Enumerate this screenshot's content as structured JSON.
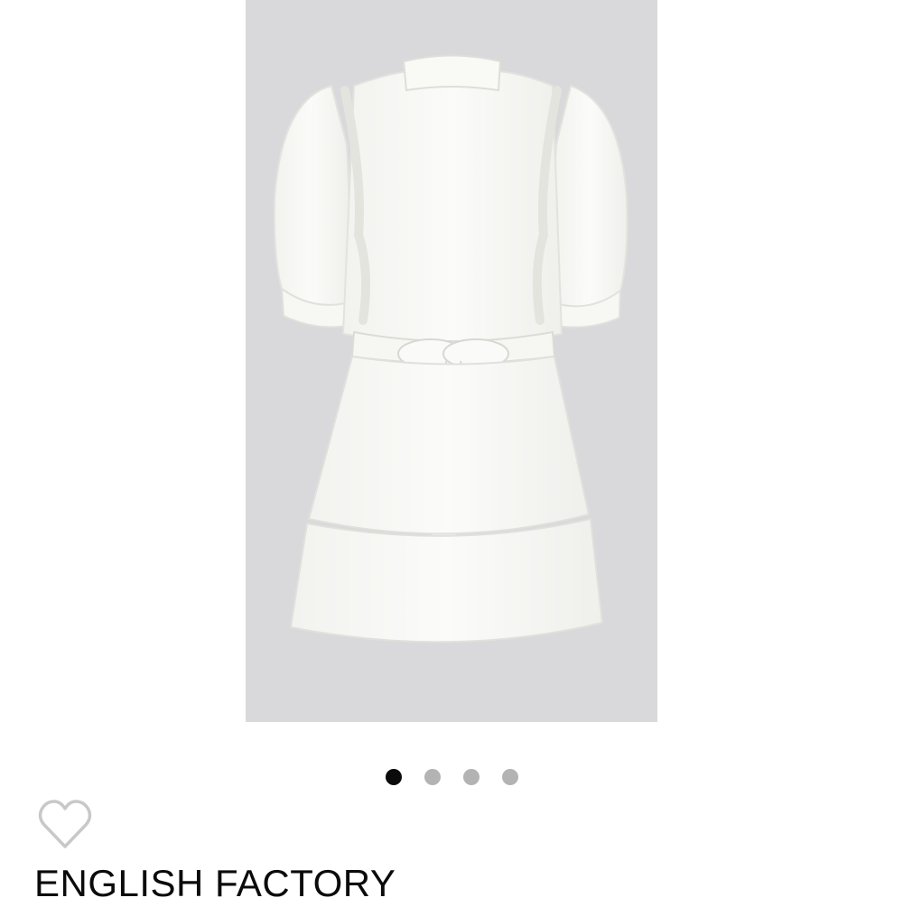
{
  "product": {
    "brand": "ENGLISH FACTORY",
    "image_icon": "dress-photo",
    "image_background": "#d9d9dc"
  },
  "carousel": {
    "total": 4,
    "active_index": 0,
    "active_color": "#0b0b0b",
    "inactive_color": "#b3b3b3"
  },
  "favorite": {
    "icon": "heart-outline-icon",
    "color": "#c8c8c8"
  }
}
